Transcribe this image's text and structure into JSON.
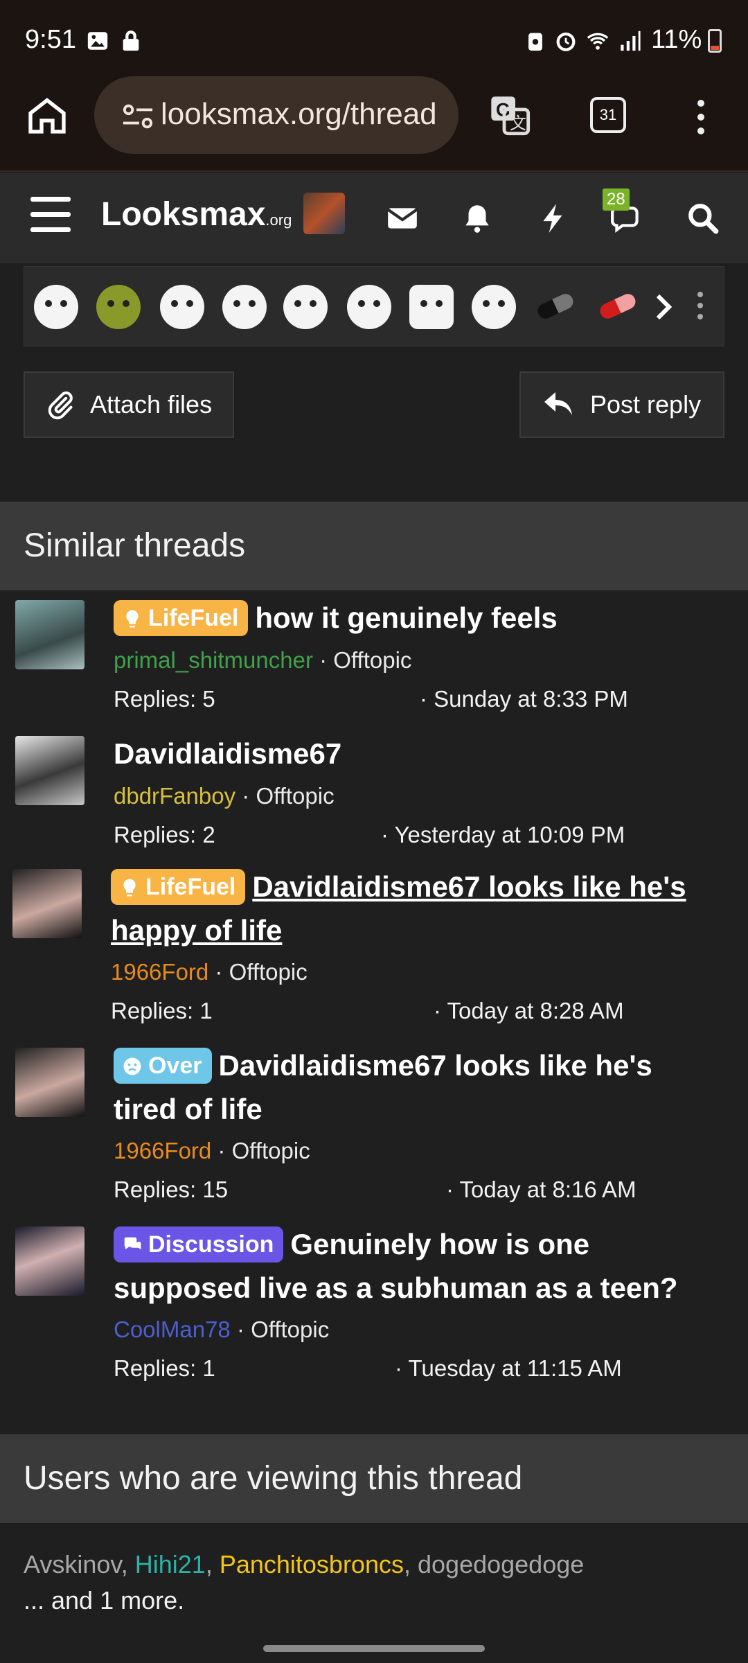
{
  "status_bar": {
    "time": "9:51",
    "battery": "11%"
  },
  "browser": {
    "url": "looksmax.org/thread",
    "tabs_count": "31"
  },
  "site_header": {
    "logo_main": "Looksmax",
    "logo_suffix": ".org",
    "badge_count": "28"
  },
  "emoji_bar": {
    "emojis": [
      "crying-wojak",
      "shrek",
      "crying-wojak-2",
      "sad-wojak",
      "smug-wojak",
      "nerd-wojak",
      "crocodile",
      "smirk-wojak",
      "black-pill",
      "red-pill"
    ]
  },
  "actions": {
    "attach_label": "Attach files",
    "reply_label": "Post reply"
  },
  "similar": {
    "heading": "Similar threads",
    "threads": [
      {
        "prefix": "LifeFuel",
        "prefix_color": "#f8b445",
        "title": "how it genuinely feels",
        "author": "primal_shitmuncher",
        "author_color": "#3fa14b",
        "forum": "Offtopic",
        "replies": "Replies: 5",
        "date": "· Sunday at 8:33 PM"
      },
      {
        "prefix": "",
        "title": "Davidlaidisme67",
        "author": "dbdrFanboy",
        "author_color": "#d8c03a",
        "forum": "Offtopic",
        "replies": "Replies: 2",
        "date": "· Yesterday at 10:09 PM"
      },
      {
        "prefix": "LifeFuel",
        "prefix_color": "#f8b445",
        "title": "Davidlaidisme67 looks like he's happy of life",
        "author": "1966Ford",
        "author_color": "#e98a1e",
        "forum": "Offtopic",
        "replies": "Replies: 1",
        "date": "· Today at 8:28 AM"
      },
      {
        "prefix": "Over",
        "prefix_color": "#6ec6e9",
        "title": "Davidlaidisme67 looks like he's tired of life",
        "author": "1966Ford",
        "author_color": "#e98a1e",
        "forum": "Offtopic",
        "replies": "Replies: 15",
        "date": "· Today at 8:16 AM"
      },
      {
        "prefix": "Discussion",
        "prefix_color": "#6a55e6",
        "title": "Genuinely how is one supposed live as a subhuman as a teen?",
        "author": "CoolMan78",
        "author_color": "#4c5fd0",
        "forum": "Offtopic",
        "replies": "Replies: 1",
        "date": "· Tuesday at 11:15 AM"
      }
    ]
  },
  "viewers": {
    "heading": "Users who are viewing this thread",
    "users": [
      {
        "name": "Avskinov",
        "color": "#a8a8a8"
      },
      {
        "name": "Hihi21",
        "color": "#2bb3a6"
      },
      {
        "name": "Panchitosbroncs",
        "color": "#f5c518"
      },
      {
        "name": "dogedogedoge",
        "color": "#a8a8a8"
      }
    ],
    "more": "... and 1 more."
  }
}
